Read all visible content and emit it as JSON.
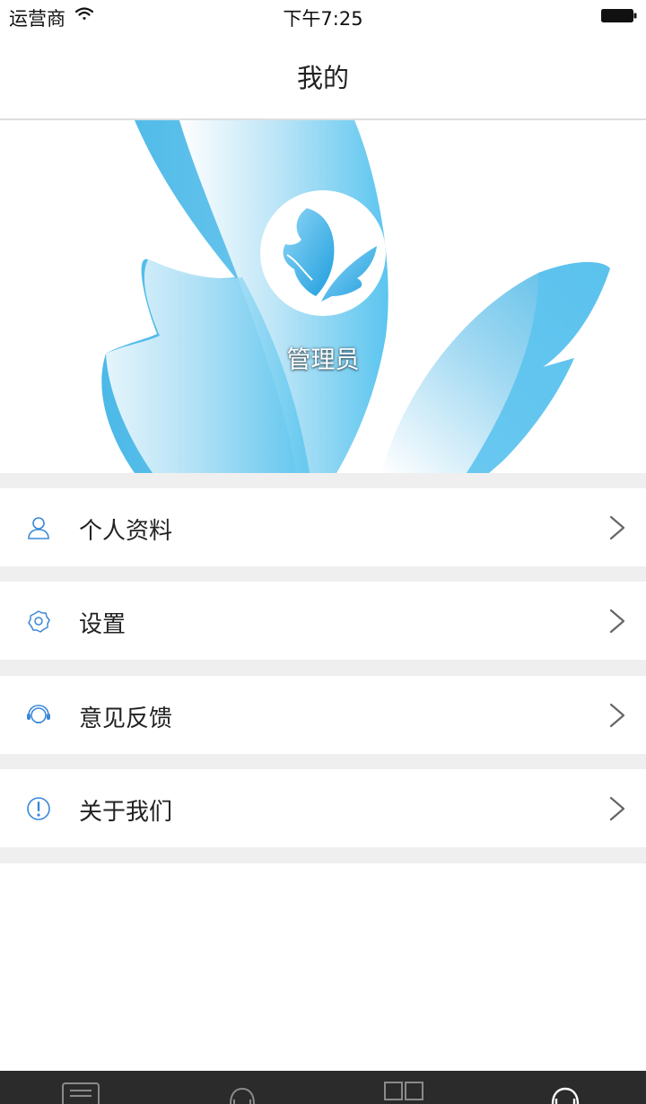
{
  "status_bar": {
    "carrier": "运营商",
    "time": "下午7:25",
    "icons": [
      "wifi-icon",
      "battery-icon"
    ]
  },
  "nav": {
    "title": "我的"
  },
  "profile": {
    "username": "管理员",
    "avatar_icon": "butterfly-logo-icon"
  },
  "menu": {
    "items": [
      {
        "label": "个人资料",
        "icon": "user-icon"
      },
      {
        "label": "设置",
        "icon": "gear-icon"
      },
      {
        "label": "意见反馈",
        "icon": "headset-icon"
      },
      {
        "label": "关于我们",
        "icon": "info-icon"
      }
    ]
  },
  "tab_bar": {
    "tabs": [
      {
        "icon": "news-icon"
      },
      {
        "icon": "service-icon"
      },
      {
        "icon": "apps-icon"
      },
      {
        "icon": "profile-icon"
      }
    ]
  },
  "colors": {
    "accent_blue": "#5bc5ef",
    "menu_icon_blue": "#3a88d8",
    "divider_gray": "#efefef",
    "tab_bar_bg": "#2b2b2b"
  }
}
